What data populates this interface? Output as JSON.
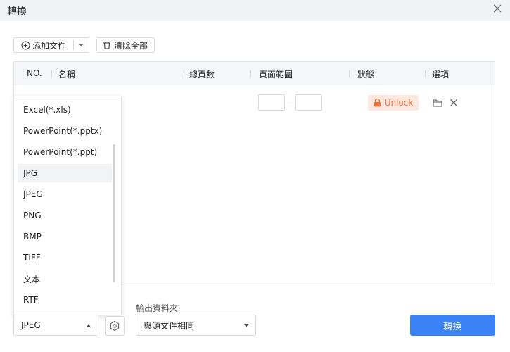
{
  "window": {
    "title": "轉換"
  },
  "toolbar": {
    "add_file_label": "添加文件",
    "clear_all_label": "清除全部"
  },
  "table": {
    "headers": [
      "NO.",
      "名稱",
      "總頁數",
      "頁面範圍",
      "狀態",
      "選項"
    ],
    "rows": [
      {
        "status_label": "Unlock"
      }
    ]
  },
  "format_dropdown": {
    "options": [
      "Excel(*.xls)",
      "PowerPoint(*.pptx)",
      "PowerPoint(*.ppt)",
      "JPG",
      "JPEG",
      "PNG",
      "BMP",
      "TIFF",
      "文本",
      "RTF"
    ],
    "highlighted": "JPG"
  },
  "format_select": {
    "value": "JPEG"
  },
  "output": {
    "label": "輸出資料夾",
    "value": "與源文件相同"
  },
  "convert_button": {
    "label": "轉換"
  },
  "colors": {
    "accent": "#3b82f6",
    "unlock_bg": "#fde7df",
    "unlock_text": "#f0743c"
  }
}
